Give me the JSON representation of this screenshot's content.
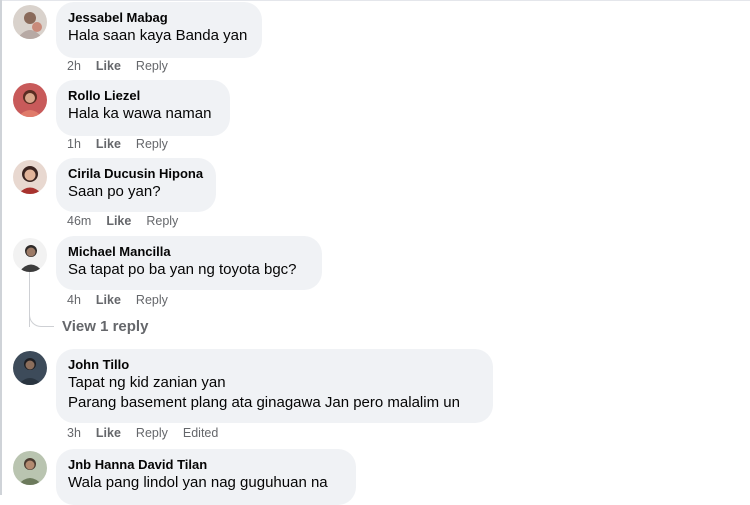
{
  "comments": [
    {
      "author": "Jessabel Mabag",
      "text": [
        "Hala saan kaya Banda yan"
      ],
      "time": "2h",
      "like": "Like",
      "reply": "Reply",
      "edited": ""
    },
    {
      "author": "Rollo Liezel",
      "text": [
        "Hala ka wawa naman"
      ],
      "time": "1h",
      "like": "Like",
      "reply": "Reply",
      "edited": ""
    },
    {
      "author": "Cirila Ducusin Hipona",
      "text": [
        "Saan po yan?"
      ],
      "time": "46m",
      "like": "Like",
      "reply": "Reply",
      "edited": ""
    },
    {
      "author": "Michael Mancilla",
      "text": [
        "Sa tapat po ba yan ng toyota bgc?"
      ],
      "time": "4h",
      "like": "Like",
      "reply": "Reply",
      "edited": ""
    },
    {
      "author": "John Tillo",
      "text": [
        "Tapat ng kid zanian yan",
        "Parang basement plang ata ginagawa Jan pero malalim un"
      ],
      "time": "3h",
      "like": "Like",
      "reply": "Reply",
      "edited": "Edited"
    },
    {
      "author": "Jnb Hanna David Tilan",
      "text": [
        "Wala pang lindol yan nag guguhuan na"
      ],
      "time": "",
      "like": "",
      "reply": "",
      "edited": ""
    }
  ],
  "view_replies": "View 1 reply",
  "colors": {
    "bubble": "#f0f2f5",
    "meta": "#65676b",
    "text": "#050505"
  }
}
